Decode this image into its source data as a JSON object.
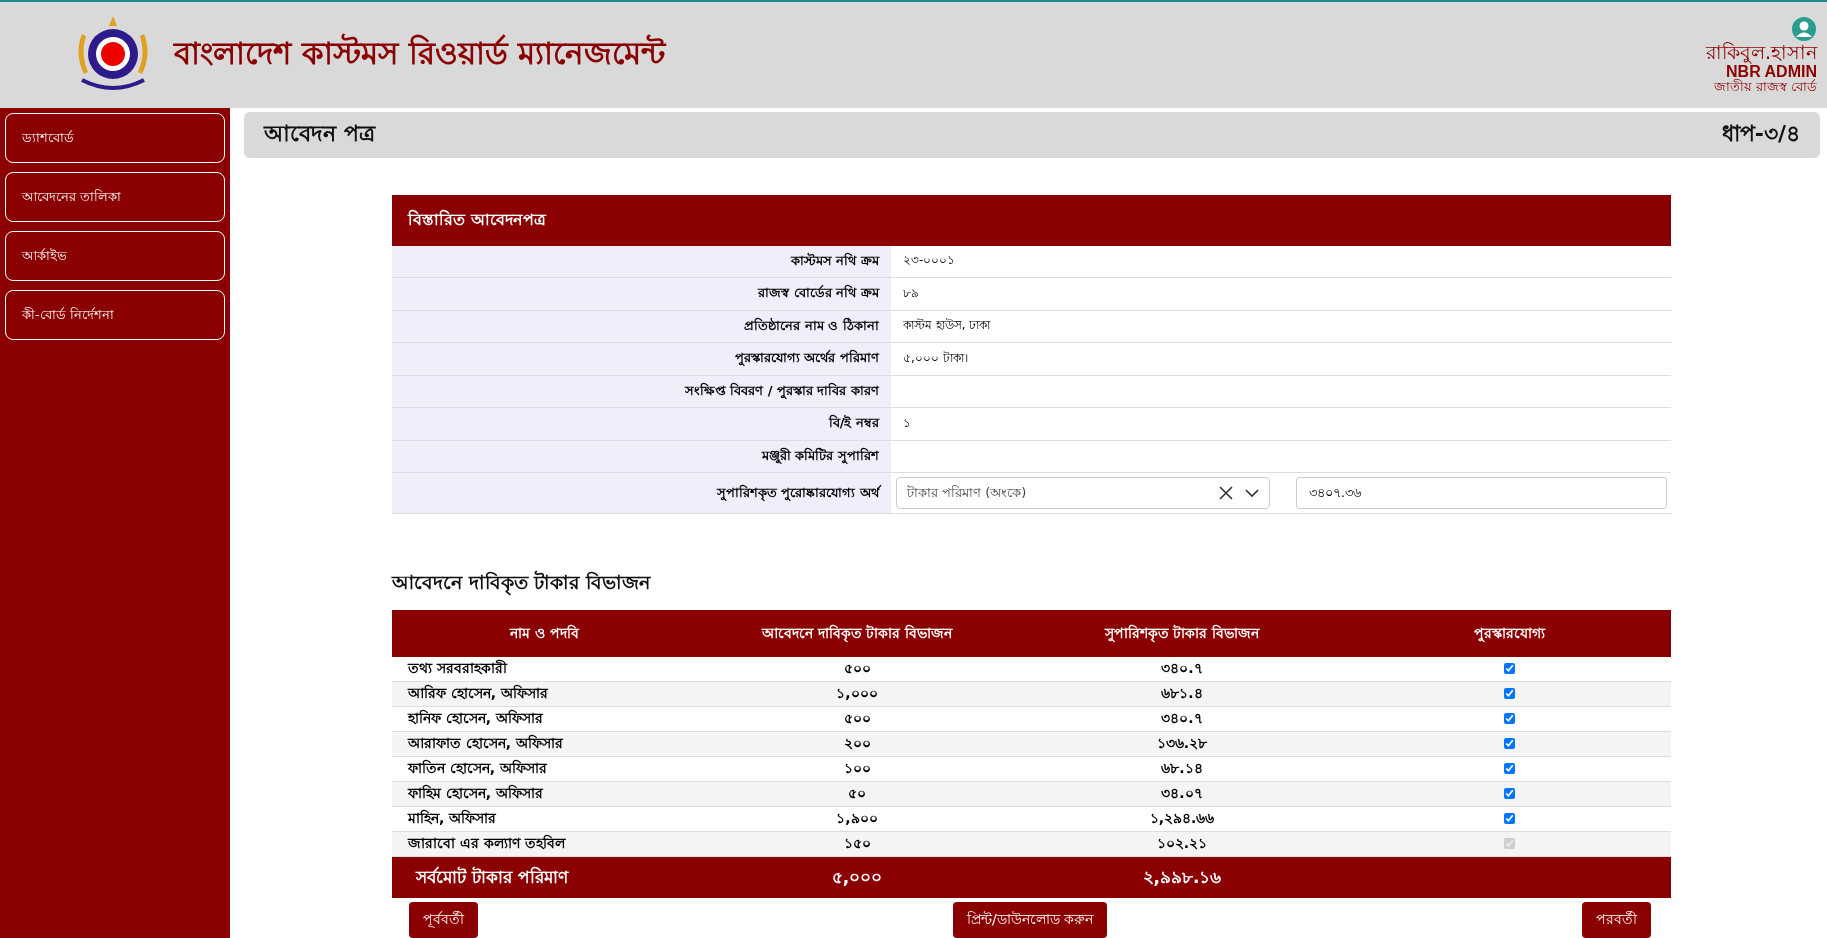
{
  "header": {
    "title": "বাংলাদেশ কাস্টমস রিওয়ার্ড ম্যানেজমেন্ট",
    "user": {
      "name": "রাকিবুল.হাসান",
      "role": "NBR ADMIN",
      "org": "জাতীয় রাজস্ব বোর্ড"
    }
  },
  "sidebar": {
    "items": [
      {
        "label": "ড্যাশবোর্ড",
        "selected": false
      },
      {
        "label": "আবেদনের তালিকা",
        "selected": false
      },
      {
        "label": "আর্কাইভ",
        "selected": false
      },
      {
        "label": "কী-বোর্ড নির্দেশনা",
        "selected": false
      }
    ]
  },
  "page": {
    "title": "আবেদন পত্র",
    "step": "ধাপ-৩/৪"
  },
  "details": {
    "title": "বিস্তারিত আবেদনপত্র",
    "rows": [
      {
        "label": "কাস্টমস নথি ক্রম",
        "value": "২৩-০০০১"
      },
      {
        "label": "রাজস্ব বোর্ডের নথি ক্রম",
        "value": "৮৯"
      },
      {
        "label": "প্রতিষ্ঠানের নাম ও ঠিকানা",
        "value": "কাস্টম হাউস, ঢাকা"
      },
      {
        "label": "পুরস্কারযোগ্য অর্থের পরিমাণ",
        "value": "৫,০০০ টাকা।"
      },
      {
        "label": "সংক্ষিপ্ত বিবরণ / পুরস্কার দাবির কারণ"
      },
      {
        "label": "বি/ই নম্বর",
        "value": "১"
      },
      {
        "label": "মঞ্জুরী কমিটির সুপারিশ"
      }
    ],
    "recommended": {
      "label": "সুপারিশকৃত পুরোষ্কারযোগ্য অর্থ",
      "select_placeholder": "টাকার পরিমাণ (অংকে)",
      "amount": "৩৪০৭.৩৬"
    }
  },
  "breakdown": {
    "title": "আবেদনে দাবিকৃত টাকার বিভাজন",
    "columns": [
      "নাম ও পদবি",
      "আবেদনে দাবিকৃত টাকার বিভাজন",
      "সুপারিশকৃত টাকার বিভাজন",
      "পুরস্কারযোগ্য"
    ],
    "rows": [
      {
        "name": "তথ্য সরবরাহকারী",
        "claimed": "৫০০",
        "recommended": "৩৪০.৭",
        "checked": true,
        "disabled": false
      },
      {
        "name": "আরিফ হোসেন, অফিসার",
        "claimed": "১,০০০",
        "recommended": "৬৮১.৪",
        "checked": true,
        "disabled": false
      },
      {
        "name": "হানিফ হোসেন, অফিসার",
        "claimed": "৫০০",
        "recommended": "৩৪০.৭",
        "checked": true,
        "disabled": false
      },
      {
        "name": "আরাফাত হোসেন, অফিসার",
        "claimed": "২০০",
        "recommended": "১৩৬.২৮",
        "checked": true,
        "disabled": false
      },
      {
        "name": "ফাতিন হোসেন, অফিসার",
        "claimed": "১০০",
        "recommended": "৬৮.১৪",
        "checked": true,
        "disabled": false
      },
      {
        "name": "ফাহিম হোসেন, অফিসার",
        "claimed": "৫০",
        "recommended": "৩৪.০৭",
        "checked": true,
        "disabled": false
      },
      {
        "name": "মাহিন, অফিসার",
        "claimed": "১,৯০০",
        "recommended": "১,২৯৪.৬৬",
        "checked": true,
        "disabled": false
      },
      {
        "name": "জারাবো এর কল্যাণ তহবিল",
        "claimed": "১৫০",
        "recommended": "১০২.২১",
        "checked": true,
        "disabled": true
      }
    ],
    "total": {
      "label": "সর্বমোট টাকার পরিমাণ",
      "claimed": "৫,০০০",
      "recommended": "২,৯৯৮.১৬"
    }
  },
  "buttons": {
    "previous": "পূর্ববর্তী",
    "print": "প্রিন্ট/ডাউনলোড করুন",
    "next": "পরবর্তী"
  }
}
